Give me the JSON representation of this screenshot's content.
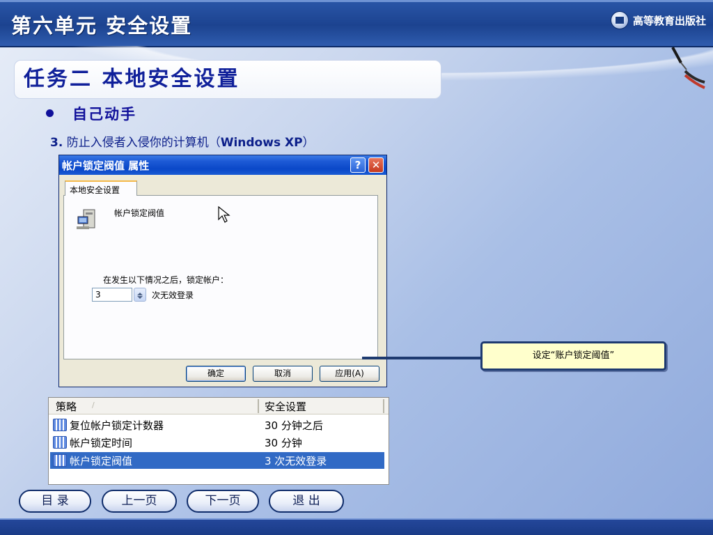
{
  "header": {
    "title": "第六单元  安全设置",
    "publisher": "高等教育出版社"
  },
  "slide": {
    "task_title": "任务二  本地安全设置",
    "bullet": "自己动手",
    "step_number": "3.",
    "step_text": " 防止入侵者入侵你的计算机（",
    "step_os": "Windows XP",
    "step_close": "）"
  },
  "dialog": {
    "title": "帐户锁定阀值 属性",
    "help_label": "?",
    "close_label": "✕",
    "tab_label": "本地安全设置",
    "policy_name": "帐户锁定阀值",
    "description": "在发生以下情况之后，锁定帐户：",
    "input_value": "3",
    "unit_label": "次无效登录",
    "buttons": {
      "ok": "确定",
      "cancel": "取消",
      "apply": "应用(A)"
    }
  },
  "callout": {
    "text": "设定“账户锁定阈值”"
  },
  "policy_list": {
    "columns": [
      "策略",
      "安全设置"
    ],
    "sort_indicator": "/",
    "rows": [
      {
        "name": "复位帐户锁定计数器",
        "value": "30 分钟之后",
        "selected": false
      },
      {
        "name": "帐户锁定时间",
        "value": "30 分钟",
        "selected": false
      },
      {
        "name": "帐户锁定阀值",
        "value": "3 次无效登录",
        "selected": true
      }
    ]
  },
  "nav": {
    "toc": "目  录",
    "prev": "上一页",
    "next": "下一页",
    "exit": "退  出"
  },
  "colors": {
    "banner": "#1c4390",
    "title_text": "#10209a",
    "callout_bg": "#ffffcc",
    "selection": "#316ac5"
  }
}
